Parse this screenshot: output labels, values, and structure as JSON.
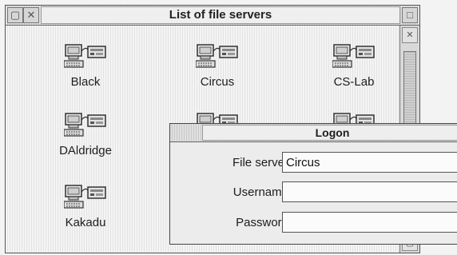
{
  "window": {
    "title": "List of file servers",
    "back_icon": "back-icon",
    "close_icon": "close-icon",
    "toggle_icon": "toggle-size-icon"
  },
  "servers": [
    {
      "label": "Black"
    },
    {
      "label": "Circus"
    },
    {
      "label": "CS-Lab"
    },
    {
      "label": "DAldridge"
    },
    {
      "label": ""
    },
    {
      "label": ""
    },
    {
      "label": "Kakadu"
    }
  ],
  "logon": {
    "title": "Logon",
    "fileserver_label": "File server",
    "fileserver_value": "Circus",
    "username_label": "Username",
    "username_value": "",
    "password_label": "Password",
    "password_value": ""
  }
}
